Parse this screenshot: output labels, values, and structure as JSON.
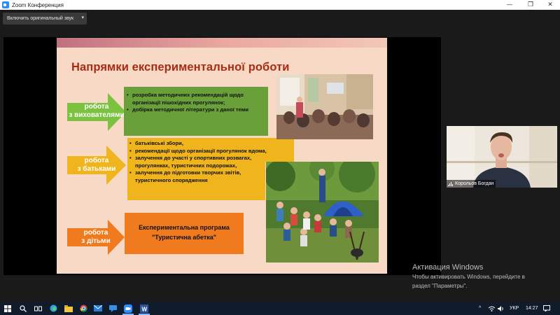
{
  "window": {
    "title": "Zoom Конференция",
    "controls": {
      "minimize": "—",
      "maximize": "❐",
      "close": "✕"
    }
  },
  "toolbar": {
    "audio_button_label": "Включить оригинальный звук",
    "audio_chevron": "▾"
  },
  "slide": {
    "title": "Напрямки експериментальної роботи",
    "sections": [
      {
        "arrow_label": "робота з вихователями",
        "arrow_lines": [
          "робота",
          "з вихователями"
        ],
        "items": [
          "розробка методичних рекомендацій щодо організації пішохідних прогулянок;",
          "добірка методичної літератури з даної теми"
        ],
        "box_color": "#6aa03a",
        "arrow_color": "#7cc241"
      },
      {
        "arrow_label": "робота з батьками",
        "arrow_lines": [
          "робота",
          "з батьками"
        ],
        "items": [
          "батьківські збори,",
          "рекомендації щодо організації прогулянок вдома,",
          "залучення до участі у спортивних розвагах, прогулянках, туристичних подорожах,",
          "залучення до підготовки творчих звітів, туристичного спорядження"
        ],
        "box_color": "#f0b41c",
        "arrow_color": "#f0b41c"
      },
      {
        "arrow_label": "робота з дітьми",
        "arrow_lines": [
          "робота",
          "з дітьми"
        ],
        "program_title": "Експериментальна програма",
        "program_name": "\"Туристична абетка\"",
        "box_color": "#f07a1e",
        "arrow_color": "#f07a1e"
      }
    ]
  },
  "participant": {
    "name": "Корольов Богдан"
  },
  "watermark": {
    "title": "Активация Windows",
    "line1": "Чтобы активировать Windows, перейдите в",
    "line2": "раздел \"Параметры\"."
  },
  "taskbar": {
    "apps": [
      "windows-start",
      "search",
      "task-view",
      "edge",
      "file-explorer",
      "chrome",
      "mail",
      "messaging",
      "zoom",
      "word"
    ],
    "tray": {
      "language": "УКР",
      "time": "14:27",
      "chevron": "^"
    }
  },
  "colors": {
    "title_red": "#a72c14",
    "slide_bg": "#f8d9c6",
    "taskbar": "#101c2c",
    "zoom_blue": "#2d8cff"
  }
}
